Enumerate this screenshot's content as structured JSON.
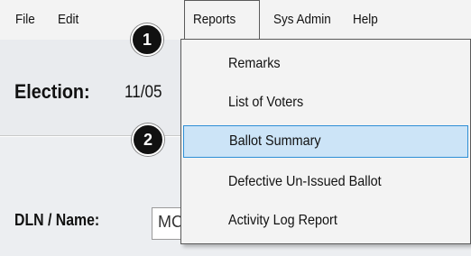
{
  "menubar": {
    "items": [
      "File",
      "Edit",
      "Reports",
      "Sys Admin",
      "Help"
    ]
  },
  "callouts": [
    "1",
    "2"
  ],
  "election": {
    "label": "Election:",
    "value": "11/05"
  },
  "dln": {
    "label": "DLN / Name:",
    "value": "MC"
  },
  "reports_menu": {
    "items": [
      "Remarks",
      "List of Voters",
      "Ballot Summary",
      "Defective Un-Issued Ballot",
      "Activity Log Report"
    ],
    "highlighted": "Ballot Summary"
  },
  "colors": {
    "highlight_bg": "#cce4f7",
    "highlight_border": "#2e8fd6"
  }
}
